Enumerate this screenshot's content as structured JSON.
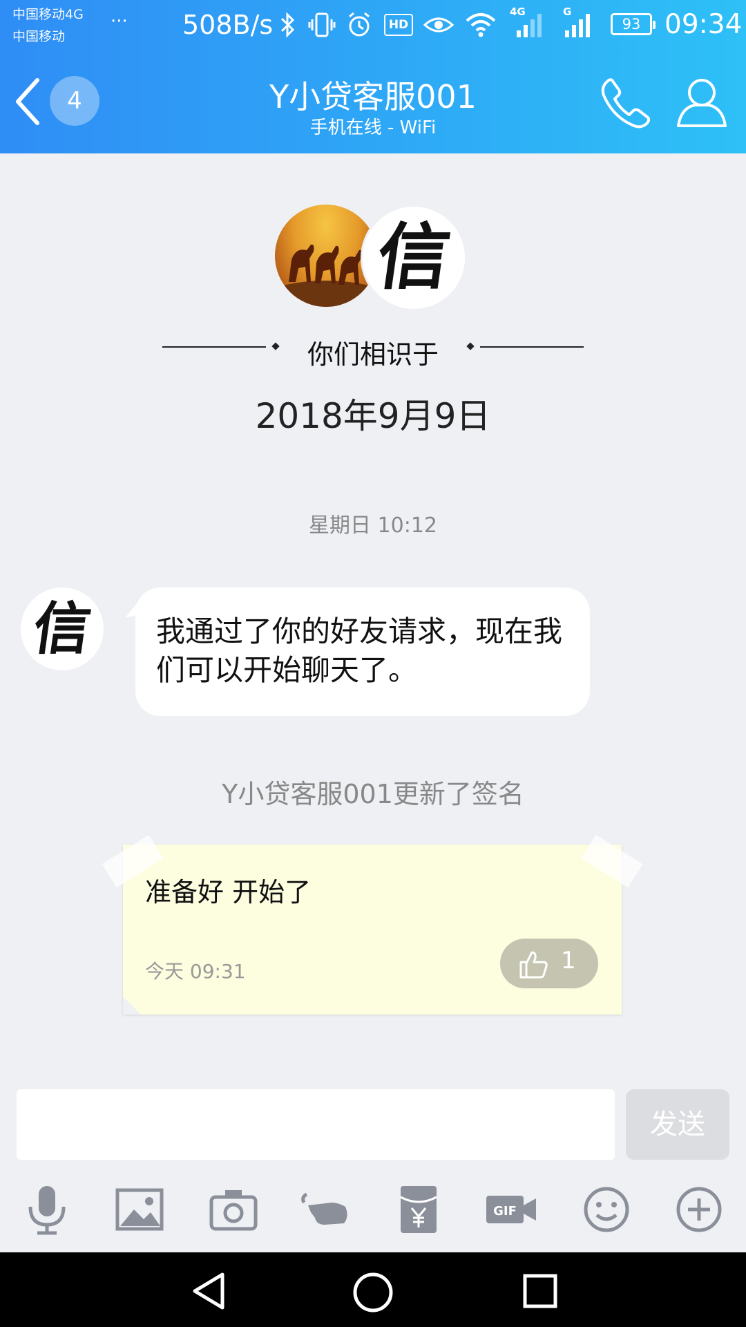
{
  "status_bar": {
    "carrier_1": "中国移动4G",
    "carrier_2": "中国移动",
    "more": "···",
    "net_speed": "508B/s",
    "hd": "HD",
    "net_4g": "4G",
    "net_g": "G",
    "battery": "93",
    "time": "09:34",
    "icons": [
      "bluetooth-icon",
      "vibrate-icon",
      "alarm-icon",
      "hd-icon",
      "eye-icon",
      "wifi-icon",
      "signal-icon",
      "signal-icon"
    ]
  },
  "header": {
    "unread_count": "4",
    "contact_name": "Y小贷客服001",
    "contact_status": "手机在线 - WiFi",
    "accent_start": "#2f8df5",
    "accent_end": "#2ec0f7"
  },
  "chat": {
    "met_label": "你们相识于",
    "met_date": "2018年9月9日",
    "timestamp": "星期日 10:12",
    "avatar_glyph": "信",
    "message": "我通过了你的好友请求，现在我们可以开始聊天了。",
    "system_note": "Y小贷客服001更新了签名",
    "signature": {
      "text": "准备好 开始了",
      "time": "今天 09:31",
      "likes": "1"
    }
  },
  "input": {
    "placeholder": "",
    "send_label": "发送"
  },
  "toolbar": {
    "items": [
      "microphone-icon",
      "image-icon",
      "camera-icon",
      "poke-icon",
      "red-packet-icon",
      "gif-icon",
      "emoji-icon",
      "plus-icon"
    ]
  }
}
